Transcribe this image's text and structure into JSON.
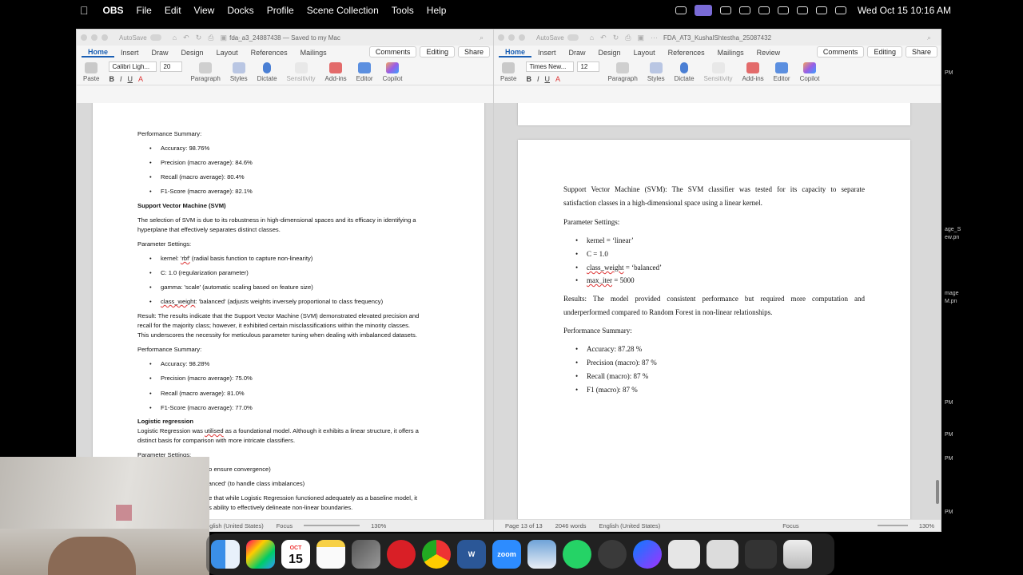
{
  "menubar": {
    "app": "OBS",
    "items": [
      "File",
      "Edit",
      "View",
      "Docks",
      "Profile",
      "Scene Collection",
      "Tools",
      "Help"
    ],
    "clock": "Wed Oct 15  10:16 AM"
  },
  "win1": {
    "autosave": "AutoSave",
    "title": "fda_a3_24887438 — Saved to my Mac",
    "tabs": [
      "Home",
      "Insert",
      "Draw",
      "Design",
      "Layout",
      "References",
      "Mailings"
    ],
    "comments": "Comments",
    "editing": "Editing",
    "share": "Share",
    "font_name": "Calibri Ligh...",
    "font_size": "20",
    "ribbon": {
      "paste": "Paste",
      "paragraph": "Paragraph",
      "styles": "Styles",
      "dictate": "Dictate",
      "sensitivity": "Sensitivity",
      "addins": "Add-ins",
      "editor": "Editor",
      "copilot": "Copilot"
    },
    "doc": {
      "perf1_heading": "Performance Summary:",
      "perf1": [
        "Accuracy: 98.76%",
        "Precision (macro average): 84.6%",
        "Recall (macro average): 80.4%",
        "F1-Score (macro average): 82.1%"
      ],
      "svm_heading": "Support Vector Machine (SVM)",
      "svm_intro1": "The selection of SVM is due to its robustness in high-dimensional spaces and its efficacy in identifying a",
      "svm_intro2": "hyperplane that effectively separates distinct classes.",
      "param_heading": "Parameter Settings:",
      "param1_a": "kernel: ",
      "param1_b": "'rbf'",
      "param1_c": " (radial basis function to capture non-linearity)",
      "param2": "C: 1.0 (regularization parameter)",
      "param3": "gamma: 'scale' (automatic scaling based on feature size)",
      "param4_a": "class_weight",
      "param4_b": ": 'balanced' (adjusts weights inversely proportional to class frequency)",
      "result1": "Result: The results indicate that the Support Vector Machine (SVM) demonstrated elevated precision and",
      "result2": "recall for the majority class; however, it exhibited certain misclassifications within the minority classes.",
      "result3": "This underscores the necessity for meticulous parameter tuning when dealing with imbalanced datasets.",
      "perf2_heading": "Performance Summary:",
      "perf2": [
        "Accuracy: 98.28%",
        "Precision (macro average): 75.0%",
        "Recall (macro average): 81.0%",
        "F1-Score (macro average): 77.0%"
      ],
      "lr_heading": "Logistic regression",
      "lr1_a": "Logistic Regression was ",
      "lr1_b": "utilised",
      "lr1_c": " as a foundational model. Although it exhibits a linear structure, it offers a",
      "lr2": "distinct basis for comparison with more intricate classifiers.",
      "lr_param": "Parameter Settings:",
      "lr_p1": "to ensure convergence)",
      "lr_p2": "lanced' (to handle class imbalances)",
      "lr_r1": "te that while Logistic Regression functioned adequately as a baseline model, it",
      "lr_r2": "ts ability to effectively delineate non-linear boundaries."
    },
    "status": {
      "lang": "nglish (United States)",
      "focus": "Focus",
      "zoom": "130%"
    }
  },
  "win2": {
    "autosave": "AutoSave",
    "title": "FDA_AT3_KushalShtestha_25087432",
    "tabs": [
      "Home",
      "Insert",
      "Draw",
      "Design",
      "Layout",
      "References",
      "Mailings",
      "Review"
    ],
    "comments": "Comments",
    "editing": "Editing",
    "share": "Share",
    "font_name": "Times New...",
    "font_size": "12",
    "ribbon": {
      "paste": "Paste",
      "paragraph": "Paragraph",
      "styles": "Styles",
      "dictate": "Dictate",
      "sensitivity": "Sensitivity",
      "addins": "Add-ins",
      "editor": "Editor",
      "copilot": "Copilot"
    },
    "doc": {
      "svm1": "Support Vector Machine (SVM): The SVM classifier was tested for its capacity to separate",
      "svm2": "satisfaction classes in a high-dimensional space using a linear kernel.",
      "param_heading": "Parameter Settings:",
      "p1": "kernel = ‘linear’",
      "p2": "C = 1.0",
      "p3_a": "class_weight",
      "p3_b": " = ‘balanced’",
      "p4_a": "max_iter",
      "p4_b": " = 5000",
      "res1": "Results: The model provided consistent performance but required more computation and",
      "res2": "underperformed compared to Random Forest in non-linear relationships.",
      "perf_heading": "Performance Summary:",
      "perf": [
        "Accuracy: 87.28 %",
        "Precision (macro): 87 %",
        "Recall (macro): 87 %",
        "F1 (macro): 87 %"
      ]
    },
    "status": {
      "page": "Page 13 of 13",
      "words": "2046 words",
      "lang": "English (United States)",
      "focus": "Focus",
      "zoom": "130%"
    }
  },
  "dock": {
    "calendar_month": "OCT",
    "calendar_day": "15",
    "apps": [
      "finder-icon",
      "launchpad-icon",
      "calendar-icon",
      "notes-icon",
      "screen-mirror-icon",
      "opera-icon",
      "chrome-icon",
      "word-icon",
      "zoom-icon",
      "preview-icon",
      "whatsapp-icon",
      "obs-icon",
      "messenger-icon",
      "window-thumb-icon",
      "window-thumb-icon",
      "window-thumb-icon",
      "trash-icon"
    ],
    "word_letter": "W",
    "zoom_label": "zoom"
  },
  "rightedge": {
    "labels": [
      "PM",
      "age_S",
      "ew.pn",
      "mage",
      "M.pn",
      "PM",
      "PM",
      "PM",
      "PM"
    ]
  },
  "colors": {
    "accent": "#1a5fb4",
    "word": "#2b5797",
    "obs": "#3a3a3a"
  }
}
